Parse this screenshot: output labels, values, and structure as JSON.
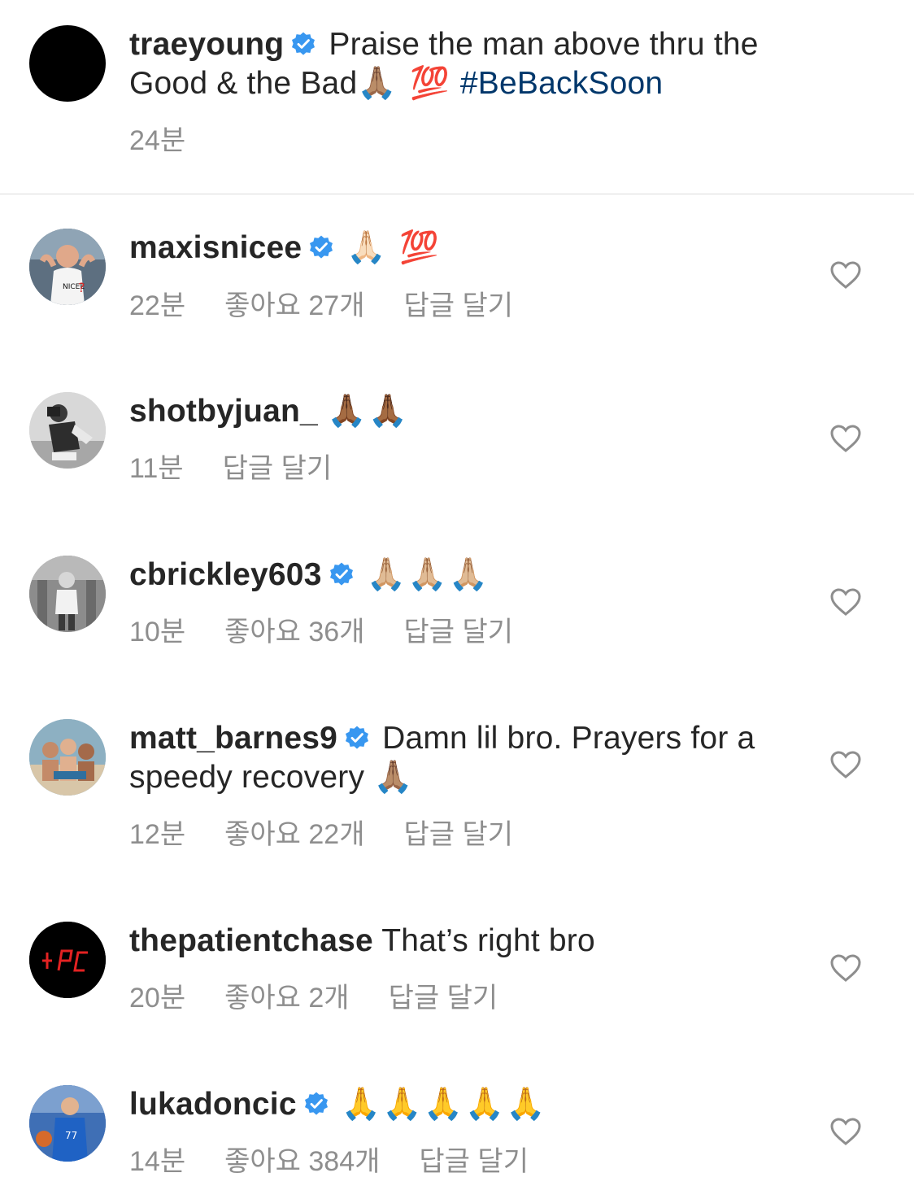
{
  "caption": {
    "username": "traeyoung",
    "text": "Praise the man above thru the Good & the Bad",
    "emoji": "🙏🏽 💯",
    "hashtag": "#BeBackSoon",
    "time": "24분"
  },
  "comments": [
    {
      "username": "maxisnicee",
      "verified": true,
      "text": "",
      "emoji": "🙏🏻 💯",
      "time": "22분",
      "likes": "좋아요 27개",
      "reply": "답글 달기"
    },
    {
      "username": "shotbyjuan_",
      "verified": false,
      "text": "",
      "emoji": "🙏🏾🙏🏾",
      "time": "11분",
      "likes": "",
      "reply": "답글 달기"
    },
    {
      "username": "cbrickley603",
      "verified": true,
      "text": "",
      "emoji": "🙏🏼🙏🏼🙏🏼",
      "time": "10분",
      "likes": "좋아요 36개",
      "reply": "답글 달기"
    },
    {
      "username": "matt_barnes9",
      "verified": true,
      "text": "Damn lil bro. Prayers for a speedy recovery",
      "emoji": "🙏🏽",
      "time": "12분",
      "likes": "좋아요 22개",
      "reply": "답글 달기"
    },
    {
      "username": "thepatientchase",
      "verified": false,
      "text": "That’s right bro",
      "emoji": "",
      "time": "20분",
      "likes": "좋아요 2개",
      "reply": "답글 달기"
    },
    {
      "username": "lukadoncic",
      "verified": true,
      "text": "",
      "emoji": "🙏🙏🙏🙏🙏",
      "time": "14분",
      "likes": "좋아요 384개",
      "reply": "답글 달기"
    }
  ],
  "icons": {
    "verified": "verified-badge-icon",
    "like": "heart-outline-icon"
  },
  "colors": {
    "verified_blue": "#3897f0",
    "meta_gray": "#8e8e8e",
    "hashtag_blue": "#00376b",
    "divider": "#dbdbdb"
  }
}
